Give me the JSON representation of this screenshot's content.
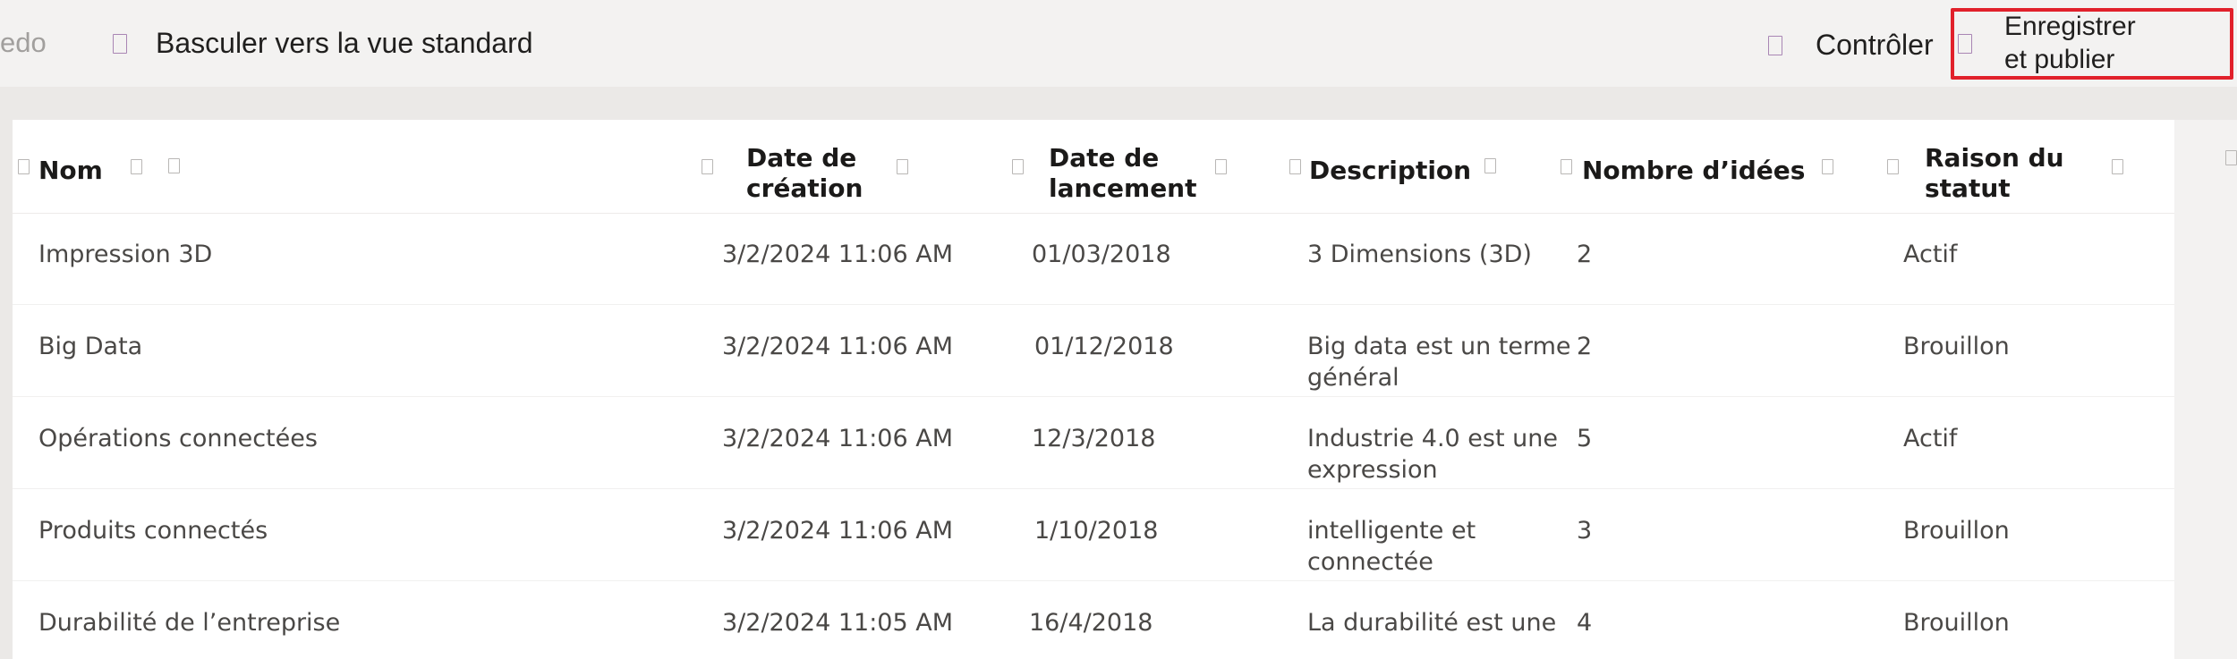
{
  "command_bar": {
    "cut_left_label": "edo",
    "switch_view_label": "Basculer vers la vue standard",
    "check_label": "Contrôler",
    "save_publish_label_line1": "Enregistrer",
    "save_publish_label_line2": "et publier",
    "highlight_color": "#e1212b"
  },
  "table": {
    "headers": {
      "name": "Nom",
      "created_line1": "Date de",
      "created_line2": "création",
      "launch_line1": "Date de",
      "launch_line2": "lancement",
      "description": "Description",
      "ideas": "Nombre d’idées",
      "status_line1": "Raison du",
      "status_line2": "statut"
    },
    "rows": [
      {
        "name": "Impression 3D",
        "created": "3/2/2024 11:06 AM",
        "launch": "01/03/2018",
        "desc1": "3 Dimensions (3D)",
        "desc2": "",
        "ideas": "2",
        "status": "Actif"
      },
      {
        "name": "Big Data",
        "created": "3/2/2024 11:06 AM",
        "launch": "01/12/2018",
        "desc1": "Big data est un terme",
        "desc2": "général",
        "ideas": "2",
        "status": "Brouillon"
      },
      {
        "name": "Opérations connectées",
        "created": "3/2/2024 11:06 AM",
        "launch": "12/3/2018",
        "desc1": "Industrie 4.0 est une",
        "desc2": "expression",
        "ideas": "5",
        "status": "Actif"
      },
      {
        "name": "Produits connectés",
        "created": "3/2/2024 11:06 AM",
        "launch": "1/10/2018",
        "desc1": "intelligente et",
        "desc2": "connectée",
        "ideas": "3",
        "status": "Brouillon"
      },
      {
        "name": "Durabilité de l’entreprise",
        "created": "3/2/2024 11:05 AM",
        "launch": "16/4/2018",
        "desc1": "La durabilité est une",
        "desc2": "",
        "ideas": "4",
        "status": "Brouillon"
      }
    ]
  }
}
